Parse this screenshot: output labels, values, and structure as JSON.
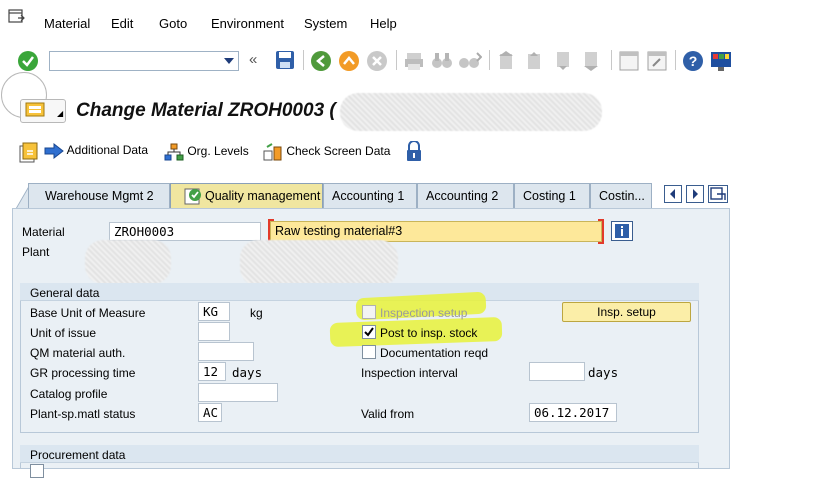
{
  "menu": {
    "items": [
      {
        "label": "Material"
      },
      {
        "label": "Edit"
      },
      {
        "label": "Goto"
      },
      {
        "label": "Environment"
      },
      {
        "label": "System"
      },
      {
        "label": "Help"
      }
    ]
  },
  "toolbar": {
    "command_field_value": ""
  },
  "title": {
    "text": "Change Material ZROH0003 ("
  },
  "app_toolbar": {
    "additional_data": "Additional Data",
    "org_levels": "Org. Levels",
    "check_screen_data": "Check Screen Data"
  },
  "tabs": [
    {
      "label": "Warehouse Mgmt 2"
    },
    {
      "label": "Quality management"
    },
    {
      "label": "Accounting 1"
    },
    {
      "label": "Accounting 2"
    },
    {
      "label": "Costing 1"
    },
    {
      "label": "Costin..."
    }
  ],
  "header": {
    "material_label": "Material",
    "material_value": "ZROH0003",
    "description_value": "Raw testing material#3",
    "plant_label": "Plant"
  },
  "general_data": {
    "title": "General data",
    "base_uom_label": "Base Unit of Measure",
    "base_uom_value": "KG",
    "base_uom_text": "kg",
    "unit_of_issue_label": "Unit of issue",
    "qm_auth_label": "QM material auth.",
    "gr_time_label": "GR processing time",
    "gr_time_value": "12",
    "gr_time_unit": "days",
    "catalog_profile_label": "Catalog profile",
    "plant_status_label": "Plant-sp.matl status",
    "plant_status_value": "AC",
    "inspection_setup_label": "Inspection setup",
    "post_insp_stock_label": "Post to insp. stock",
    "doc_reqd_label": "Documentation reqd",
    "insp_interval_label": "Inspection interval",
    "insp_interval_unit": "days",
    "valid_from_label": "Valid from",
    "valid_from_value": "06.12.2017",
    "insp_setup_button": "Insp. setup"
  },
  "procurement": {
    "title": "Procurement data"
  }
}
